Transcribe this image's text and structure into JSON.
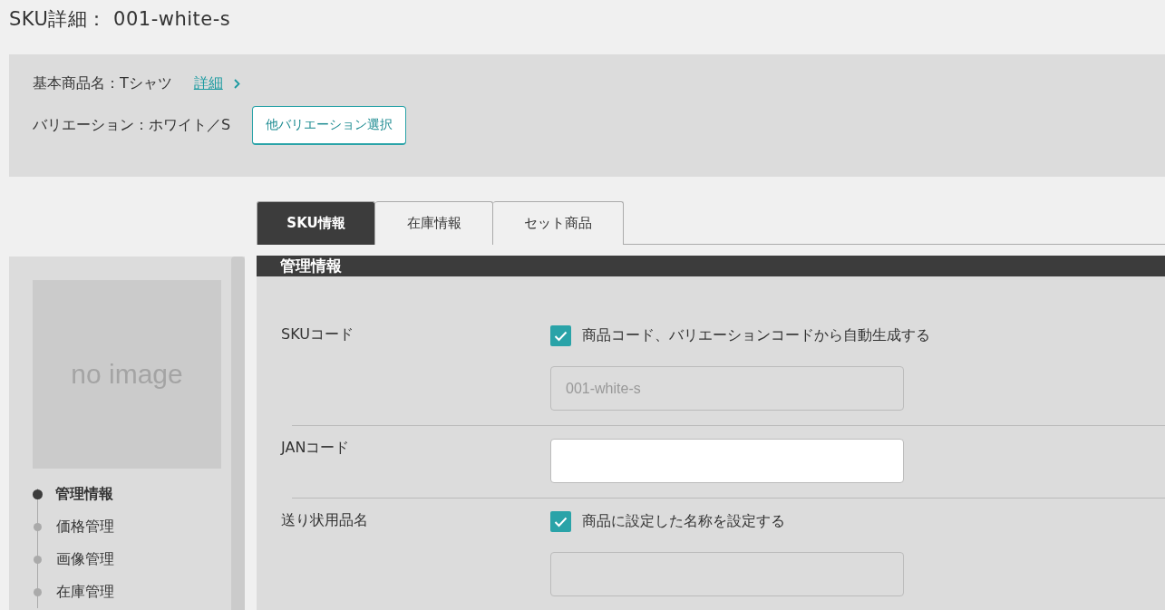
{
  "page_title": "SKU詳細： 001-white-s",
  "summary": {
    "product_label": "基本商品名：Tシャツ",
    "detail_link": "詳細",
    "variation_label": "バリエーション：ホワイト／S",
    "variation_button": "他バリエーション選択"
  },
  "sidebar": {
    "image_text": "no image",
    "nav": [
      {
        "label": "管理情報",
        "selected": true
      },
      {
        "label": "価格管理",
        "selected": false
      },
      {
        "label": "画像管理",
        "selected": false
      },
      {
        "label": "在庫管理",
        "selected": false
      }
    ]
  },
  "tabs": [
    {
      "label": "SKU情報",
      "selected": true
    },
    {
      "label": "在庫情報",
      "selected": false
    },
    {
      "label": "セット商品",
      "selected": false
    }
  ],
  "section": {
    "title": "管理情報",
    "fields": [
      {
        "label": "SKUコード",
        "kind": "auto",
        "checkbox": {
          "label": "商品コード、バリエーションコードから自動生成する",
          "checked": true
        },
        "input": {
          "value": "001-white-s",
          "disabled": true
        }
      },
      {
        "label": "JANコード",
        "kind": "input",
        "input": {
          "disabled": false
        }
      },
      {
        "label": "送り状用品名",
        "kind": "auto",
        "checkbox": {
          "label": "商品に設定した名称を設定する",
          "checked": true
        },
        "input": {
          "disabled": true
        }
      }
    ]
  }
}
